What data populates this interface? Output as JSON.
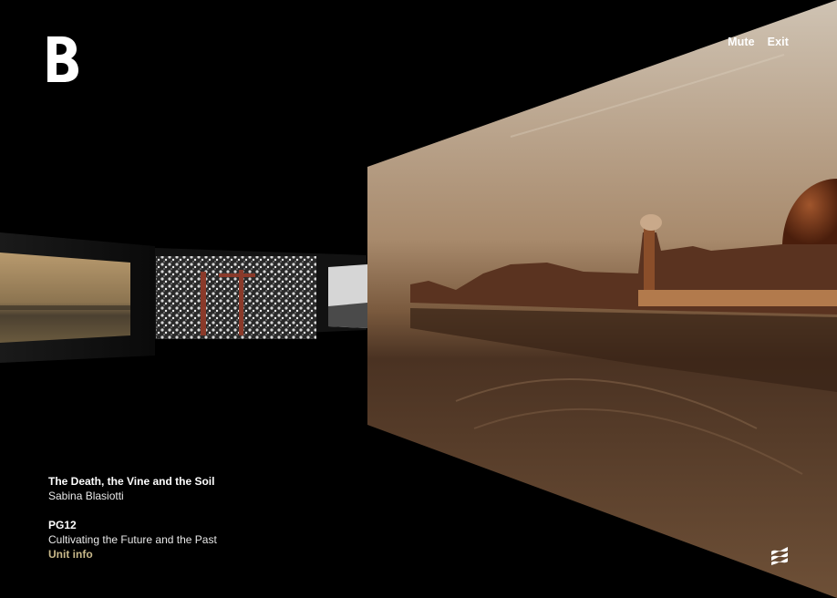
{
  "header": {
    "logo_letter": "B",
    "mute_label": "Mute",
    "exit_label": "Exit"
  },
  "artwork": {
    "title": "The Death, the Vine and the Soil",
    "artist": "Sabina Blasiotti"
  },
  "unit": {
    "code": "PG12",
    "description": "Cultivating the Future and the Past",
    "link_label": "Unit info"
  },
  "icons": {
    "logo": "bartlett-b-logo",
    "menu": "layers-menu-icon"
  },
  "colors": {
    "background": "#000000",
    "text": "#ffffff",
    "accent": "#c9b98a"
  }
}
